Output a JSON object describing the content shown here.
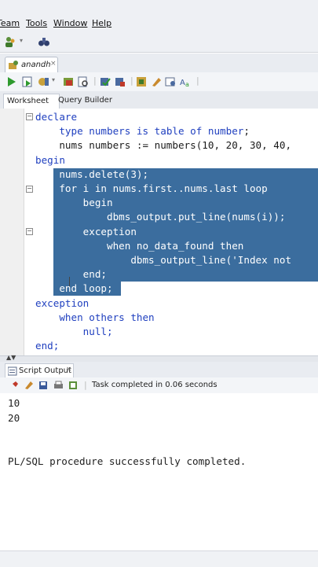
{
  "menubar": {
    "items": [
      {
        "label": "Team"
      },
      {
        "label": "Tools"
      },
      {
        "label": "Window"
      },
      {
        "label": "Help"
      }
    ]
  },
  "document_tab": {
    "label": "anandh",
    "close": "×"
  },
  "editor_tabs": {
    "worksheet": "Worksheet",
    "query_builder": "Query Builder"
  },
  "code": [
    {
      "segments": [
        {
          "t": "declare",
          "k": "kw"
        }
      ]
    },
    {
      "segments": [
        {
          "t": "    type numbers ",
          "k": "kw"
        },
        {
          "t": "is table of number",
          "k": "kw"
        },
        {
          "t": ";",
          "k": "pl"
        }
      ]
    },
    {
      "segments": [
        {
          "t": "    nums numbers := numbers(10, 20, 30, 40,",
          "k": "pl"
        }
      ]
    },
    {
      "segments": [
        {
          "t": "begin",
          "k": "kw"
        }
      ]
    },
    {
      "segments": [
        {
          "t": "    nums.delete(3);",
          "k": "selw"
        }
      ]
    },
    {
      "segments": [
        {
          "t": "    for i in nums.first..nums.last loop",
          "k": "selw"
        }
      ]
    },
    {
      "segments": [
        {
          "t": "        begin",
          "k": "selw"
        }
      ]
    },
    {
      "segments": [
        {
          "t": "            dbms_output.put_line(nums(i));",
          "k": "selw"
        }
      ]
    },
    {
      "segments": [
        {
          "t": "        exception",
          "k": "selw"
        }
      ]
    },
    {
      "segments": [
        {
          "t": "            when no_data_found then",
          "k": "selw"
        }
      ]
    },
    {
      "segments": [
        {
          "t": "                dbms_output_line('Index not",
          "k": "selw"
        }
      ]
    },
    {
      "segments": [
        {
          "t": "        end;",
          "k": "selw"
        }
      ]
    },
    {
      "segments": [
        {
          "t": "    end loop;",
          "k": "selw"
        }
      ]
    },
    {
      "segments": [
        {
          "t": "exception",
          "k": "kw"
        }
      ]
    },
    {
      "segments": [
        {
          "t": "    when others then",
          "k": "kw"
        }
      ]
    },
    {
      "segments": [
        {
          "t": "        null;",
          "k": "kw"
        }
      ]
    },
    {
      "segments": [
        {
          "t": "end;",
          "k": "kw"
        }
      ]
    }
  ],
  "output_panel": {
    "tab_label": "Script Output",
    "close": "×",
    "status": "Task completed in 0.06 seconds",
    "lines": [
      "10",
      "20",
      "",
      "",
      "PL/SQL procedure successfully completed."
    ]
  },
  "colors": {
    "selection": "#3b6d9e",
    "keyword": "#1f3fbf",
    "menubar_bg": "#eef0f4"
  }
}
